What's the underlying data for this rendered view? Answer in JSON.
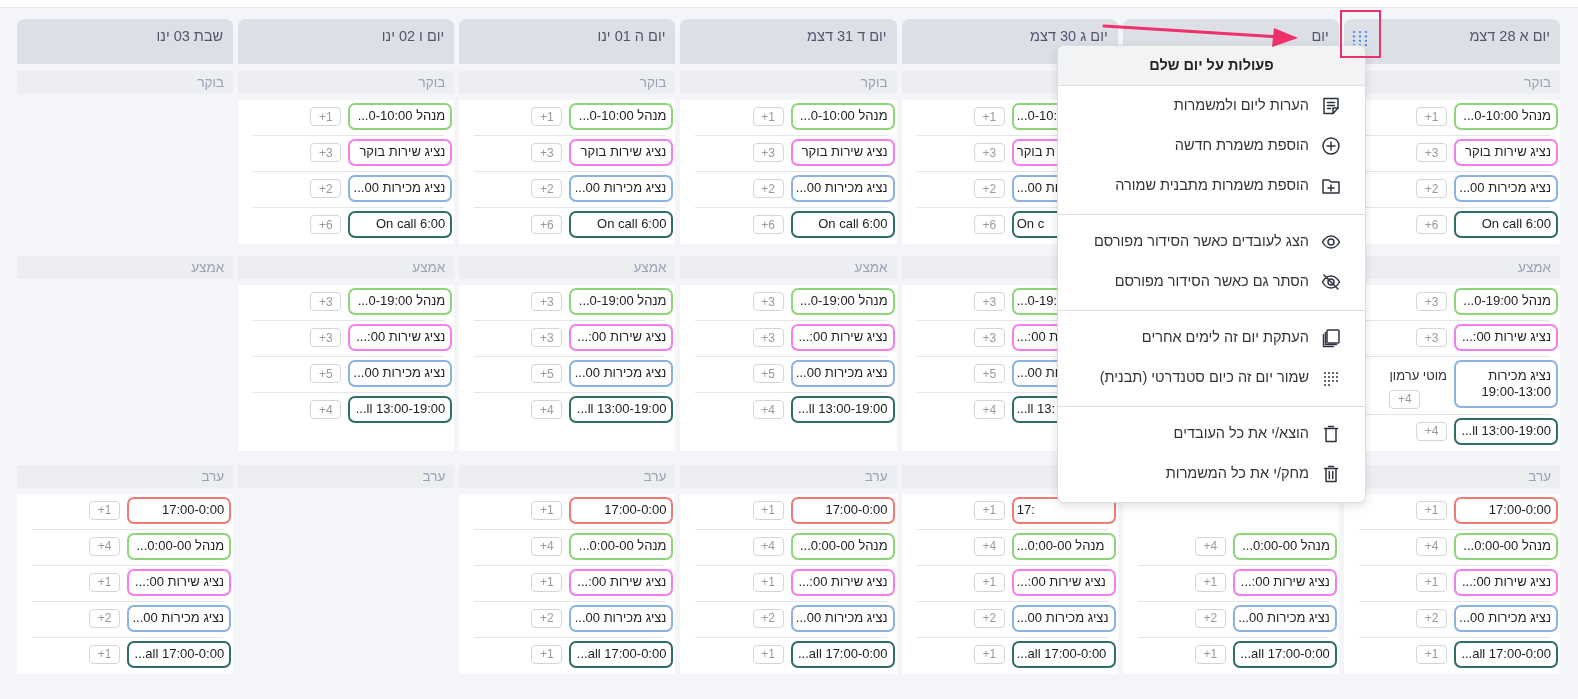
{
  "days": [
    {
      "title": "יום א 28 דצמ",
      "menu_open": true,
      "sections": {
        "morning": {
          "label": "בוקר",
          "shifts": [
            {
              "text": "מנהל 0-10:00...",
              "color": "#8ed57a",
              "count": "+1"
            },
            {
              "text": "נציג שירות בוקר",
              "color": "#f27ef0",
              "count": "+3"
            },
            {
              "text": "נציג מכירות 00...",
              "color": "#8ab2e2",
              "count": "+2"
            },
            {
              "text": "On call 6:00",
              "color": "#2f6e66",
              "count": "+6"
            }
          ]
        },
        "middle": {
          "label": "אמצע",
          "shifts": [
            {
              "text": "מנהל 0-19:00...",
              "color": "#8ed57a",
              "count": "+3"
            },
            {
              "text": "נציג שירות 00:...",
              "color": "#f27ef0",
              "count": "+3"
            },
            {
              "text": "נציג מכירות 19:00-13:00",
              "color": "#8ab2e2",
              "count": "+4",
              "employee": "מוטי ערמון"
            },
            {
              "text": "...ll 13:00-19:00",
              "color": "#2f6e66",
              "count": "+4"
            }
          ]
        },
        "evening": {
          "label": "ערב",
          "shifts": [
            {
              "text": "17:00-0:00",
              "color": "#f07b74",
              "count": "+1"
            },
            {
              "text": "מנהל 0:00-00...",
              "color": "#8ed57a",
              "count": "+4"
            },
            {
              "text": "נציג שירות 00:...",
              "color": "#f27ef0",
              "count": "+1"
            },
            {
              "text": "נציג מכירות 00...",
              "color": "#8ab2e2",
              "count": "+2"
            },
            {
              "text": "...all 17:00-0:00",
              "color": "#2f6e66",
              "count": "+1"
            }
          ]
        }
      }
    },
    {
      "title": "יום",
      "menu_open": false,
      "sections": {
        "evening": {
          "shifts": [
            {
              "text": "מנהל 0:00-00...",
              "color": "#8ed57a",
              "count": "+4"
            },
            {
              "text": "נציג שירות 00:...",
              "color": "#f27ef0",
              "count": "+1"
            },
            {
              "text": "נציג מכירות 00...",
              "color": "#8ab2e2",
              "count": "+2"
            },
            {
              "text": "...all 17:00-0:00",
              "color": "#2f6e66",
              "count": "+1"
            }
          ]
        }
      }
    },
    {
      "title": "יום ג 30 דצמ",
      "menu_open": false,
      "sections": {
        "morning": {
          "shifts": [
            {
              "text": "...0-10:",
              "color": "#8ed57a",
              "count": "+1"
            },
            {
              "text": "ת בוקר",
              "color": "#f27ef0",
              "count": "+3"
            },
            {
              "text": "ות 00...",
              "color": "#8ab2e2",
              "count": "+2"
            },
            {
              "text": "On c",
              "color": "#2f6e66",
              "count": "+6"
            }
          ]
        },
        "middle": {
          "shifts": [
            {
              "text": "...0-19:",
              "color": "#8ed57a",
              "count": "+3"
            },
            {
              "text": "ת 00:...",
              "color": "#f27ef0",
              "count": "+3"
            },
            {
              "text": "ות 00...",
              "color": "#8ab2e2",
              "count": "+5"
            },
            {
              "text": "...ll 13:",
              "color": "#2f6e66",
              "count": "+4"
            }
          ]
        },
        "evening": {
          "shifts": [
            {
              "text": "17:",
              "color": "#f07b74",
              "count": "+1"
            },
            {
              "text": "מנהל 0:00-00...",
              "color": "#8ed57a",
              "count": "+4"
            },
            {
              "text": "נציג שירות 00:...",
              "color": "#f27ef0",
              "count": "+1"
            },
            {
              "text": "נציג מכירות 00...",
              "color": "#8ab2e2",
              "count": "+2"
            },
            {
              "text": "...all 17:00-0:00",
              "color": "#2f6e66",
              "count": "+1"
            }
          ]
        }
      }
    },
    {
      "title": "יום ד 31 דצמ",
      "menu_open": false,
      "sections": {
        "morning": {
          "label": "בוקר",
          "shifts": [
            {
              "text": "מנהל 0-10:00...",
              "color": "#8ed57a",
              "count": "+1"
            },
            {
              "text": "נציג שירות בוקר",
              "color": "#f27ef0",
              "count": "+3"
            },
            {
              "text": "נציג מכירות 00...",
              "color": "#8ab2e2",
              "count": "+2"
            },
            {
              "text": "On call 6:00",
              "color": "#2f6e66",
              "count": "+6"
            }
          ]
        },
        "middle": {
          "label": "אמצע",
          "shifts": [
            {
              "text": "מנהל 0-19:00...",
              "color": "#8ed57a",
              "count": "+3"
            },
            {
              "text": "נציג שירות 00:...",
              "color": "#f27ef0",
              "count": "+3"
            },
            {
              "text": "נציג מכירות 00...",
              "color": "#8ab2e2",
              "count": "+5"
            },
            {
              "text": "...ll 13:00-19:00",
              "color": "#2f6e66",
              "count": "+4"
            }
          ]
        },
        "evening": {
          "label": "ערב",
          "shifts": [
            {
              "text": "17:00-0:00",
              "color": "#f07b74",
              "count": "+1"
            },
            {
              "text": "מנהל 0:00-00...",
              "color": "#8ed57a",
              "count": "+4"
            },
            {
              "text": "נציג שירות 00:...",
              "color": "#f27ef0",
              "count": "+1"
            },
            {
              "text": "נציג מכירות 00...",
              "color": "#8ab2e2",
              "count": "+2"
            },
            {
              "text": "...all 17:00-0:00",
              "color": "#2f6e66",
              "count": "+1"
            }
          ]
        }
      }
    },
    {
      "title": "יום ה 01 ינו",
      "menu_open": false,
      "sections": {
        "morning": {
          "label": "בוקר",
          "shifts": [
            {
              "text": "מנהל 0-10:00...",
              "color": "#8ed57a",
              "count": "+1"
            },
            {
              "text": "נציג שירות בוקר",
              "color": "#f27ef0",
              "count": "+3"
            },
            {
              "text": "נציג מכירות 00...",
              "color": "#8ab2e2",
              "count": "+2"
            },
            {
              "text": "On call 6:00",
              "color": "#2f6e66",
              "count": "+6"
            }
          ]
        },
        "middle": {
          "label": "אמצע",
          "shifts": [
            {
              "text": "מנהל 0-19:00...",
              "color": "#8ed57a",
              "count": "+3"
            },
            {
              "text": "נציג שירות 00:...",
              "color": "#f27ef0",
              "count": "+3"
            },
            {
              "text": "נציג מכירות 00...",
              "color": "#8ab2e2",
              "count": "+5"
            },
            {
              "text": "...ll 13:00-19:00",
              "color": "#2f6e66",
              "count": "+4"
            }
          ]
        },
        "evening": {
          "label": "ערב",
          "shifts": [
            {
              "text": "17:00-0:00",
              "color": "#f07b74",
              "count": "+1"
            },
            {
              "text": "מנהל 0:00-00...",
              "color": "#8ed57a",
              "count": "+4"
            },
            {
              "text": "נציג שירות 00:...",
              "color": "#f27ef0",
              "count": "+1"
            },
            {
              "text": "נציג מכירות 00...",
              "color": "#8ab2e2",
              "count": "+2"
            },
            {
              "text": "...all 17:00-0:00",
              "color": "#2f6e66",
              "count": "+1"
            }
          ]
        }
      }
    },
    {
      "title": "יום ו 02 ינו",
      "menu_open": false,
      "sections": {
        "morning": {
          "label": "בוקר",
          "shifts": [
            {
              "text": "מנהל 0-10:00...",
              "color": "#8ed57a",
              "count": "+1"
            },
            {
              "text": "נציג שירות בוקר",
              "color": "#f27ef0",
              "count": "+3"
            },
            {
              "text": "נציג מכירות 00...",
              "color": "#8ab2e2",
              "count": "+2"
            },
            {
              "text": "On call 6:00",
              "color": "#2f6e66",
              "count": "+6"
            }
          ]
        },
        "middle": {
          "label": "אמצע",
          "shifts": [
            {
              "text": "מנהל 0-19:00...",
              "color": "#8ed57a",
              "count": "+3"
            },
            {
              "text": "נציג שירות 00:...",
              "color": "#f27ef0",
              "count": "+3"
            },
            {
              "text": "נציג מכירות 00...",
              "color": "#8ab2e2",
              "count": "+5"
            },
            {
              "text": "...ll 13:00-19:00",
              "color": "#2f6e66",
              "count": "+4"
            }
          ]
        },
        "evening": {
          "label": "ערב"
        }
      }
    },
    {
      "title": "שבת 03 ינו",
      "menu_open": false,
      "sections": {
        "morning": {
          "label": "בוקר"
        },
        "middle": {
          "label": "אמצע"
        },
        "evening": {
          "label": "ערב",
          "shifts": [
            {
              "text": "17:00-0:00",
              "color": "#f07b74",
              "count": "+1"
            },
            {
              "text": "מנהל 0:00-00...",
              "color": "#8ed57a",
              "count": "+4"
            },
            {
              "text": "נציג שירות 00:...",
              "color": "#f27ef0",
              "count": "+1"
            },
            {
              "text": "נציג מכירות 00...",
              "color": "#8ab2e2",
              "count": "+2"
            },
            {
              "text": "...all 17:00-0:00",
              "color": "#2f6e66",
              "count": "+1"
            }
          ]
        }
      }
    }
  ],
  "day_menu": {
    "title": "פעולות על יום שלם",
    "groups": [
      {
        "items": [
          {
            "kind": "notes",
            "label": "הערות ליום ולמשמרות"
          },
          {
            "kind": "add",
            "label": "הוספת משמרת חדשה"
          },
          {
            "kind": "folder",
            "label": "הוספת משמרות מתבנית שמורה"
          }
        ]
      },
      {
        "items": [
          {
            "kind": "show",
            "label": "הצג לעובדים כאשר הסידור מפורסם"
          },
          {
            "kind": "hide",
            "label": "הסתר גם כאשר הסידור מפורסם"
          }
        ]
      },
      {
        "items": [
          {
            "kind": "copy",
            "label": "העתקת יום זה לימים אחרים"
          },
          {
            "kind": "template",
            "label": "שמור יום זה כיום סטנדרטי (תבנית)"
          }
        ]
      },
      {
        "items": [
          {
            "kind": "remove",
            "label": "הוצא/י את כל העובדים"
          },
          {
            "kind": "delete",
            "label": "מחק/י את כל המשמרות"
          }
        ]
      }
    ]
  }
}
